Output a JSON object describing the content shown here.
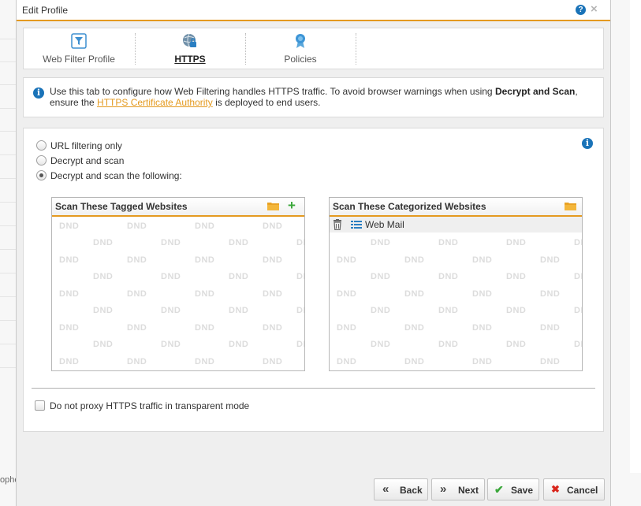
{
  "dialog": {
    "title": "Edit Profile",
    "help_icon": "?",
    "close_icon": "×"
  },
  "background": {
    "left_text": "ophe"
  },
  "tabs": [
    {
      "label": "Web Filter Profile",
      "icon": "filter-icon",
      "active": false
    },
    {
      "label": "HTTPS",
      "icon": "globe-lock-icon",
      "active": true
    },
    {
      "label": "Policies",
      "icon": "ribbon-icon",
      "active": false
    }
  ],
  "info": {
    "text_1": "Use this tab to configure how Web Filtering handles HTTPS traffic. To avoid browser warnings when using ",
    "bold": "Decrypt and Scan",
    "text_2": ",",
    "text_3": "ensure the ",
    "link": "HTTPS Certificate Authority",
    "text_4": " is deployed to end users.",
    "icon_glyph": "i"
  },
  "options": {
    "radios": [
      {
        "label": "URL filtering only",
        "checked": false
      },
      {
        "label": "Decrypt and scan",
        "checked": false
      },
      {
        "label": "Decrypt and scan the following:",
        "checked": true
      }
    ],
    "info_icon_glyph": "i"
  },
  "panels": {
    "tagged": {
      "title": "Scan These Tagged Websites",
      "add_glyph": "+",
      "placeholder": "DND",
      "items": []
    },
    "categorized": {
      "title": "Scan These Categorized Websites",
      "placeholder": "DND",
      "items": [
        "Web Mail"
      ]
    }
  },
  "transparent_mode": {
    "label": "Do not proxy HTTPS traffic in transparent mode",
    "checked": false
  },
  "buttons": {
    "back": {
      "label": "Back",
      "glyph": "«"
    },
    "next": {
      "label": "Next",
      "glyph": "»"
    },
    "save": {
      "label": "Save",
      "glyph": "✔"
    },
    "cancel": {
      "label": "Cancel",
      "glyph": "✖"
    }
  },
  "colors": {
    "accent": "#e49a20",
    "info_blue": "#1a73b8",
    "add_green": "#3aa73a",
    "cancel_red": "#d9261c"
  }
}
